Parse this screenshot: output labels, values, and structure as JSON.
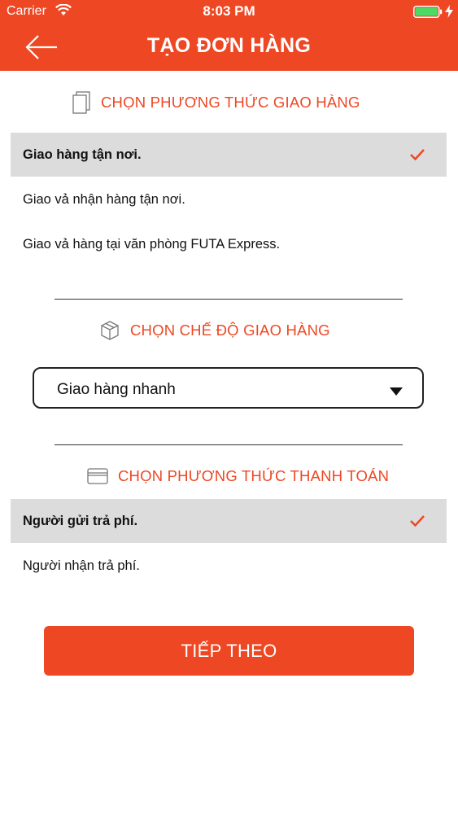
{
  "status_bar": {
    "carrier": "Carrier",
    "time": "8:03 PM"
  },
  "header": {
    "title": "TẠO ĐƠN HÀNG",
    "back_icon": "arrow-left-icon"
  },
  "delivery_method": {
    "heading": "CHỌN PHƯƠNG THỨC GIAO HÀNG",
    "icon": "document-icon",
    "options": [
      {
        "label": "Giao hàng tận nơi.",
        "selected": true
      },
      {
        "label": "Giao vả nhận hàng tận nơi.",
        "selected": false
      },
      {
        "label": "Giao vả hàng tại văn phòng FUTA Express.",
        "selected": false
      }
    ]
  },
  "delivery_mode": {
    "heading": "CHỌN CHẾ ĐỘ GIAO HÀNG",
    "icon": "package-icon",
    "selected_value": "Giao hàng nhanh"
  },
  "payment_method": {
    "heading": "CHỌN PHƯƠNG THỨC THANH TOÁN",
    "icon": "card-icon",
    "options": [
      {
        "label": "Người gửi trả phí.",
        "selected": true
      },
      {
        "label": "Người nhận trả phí.",
        "selected": false
      }
    ]
  },
  "next_button": {
    "label": "TIẾP THEO"
  },
  "colors": {
    "accent": "#ee4723",
    "selected_row": "#dcdcdc",
    "text": "#111111"
  }
}
